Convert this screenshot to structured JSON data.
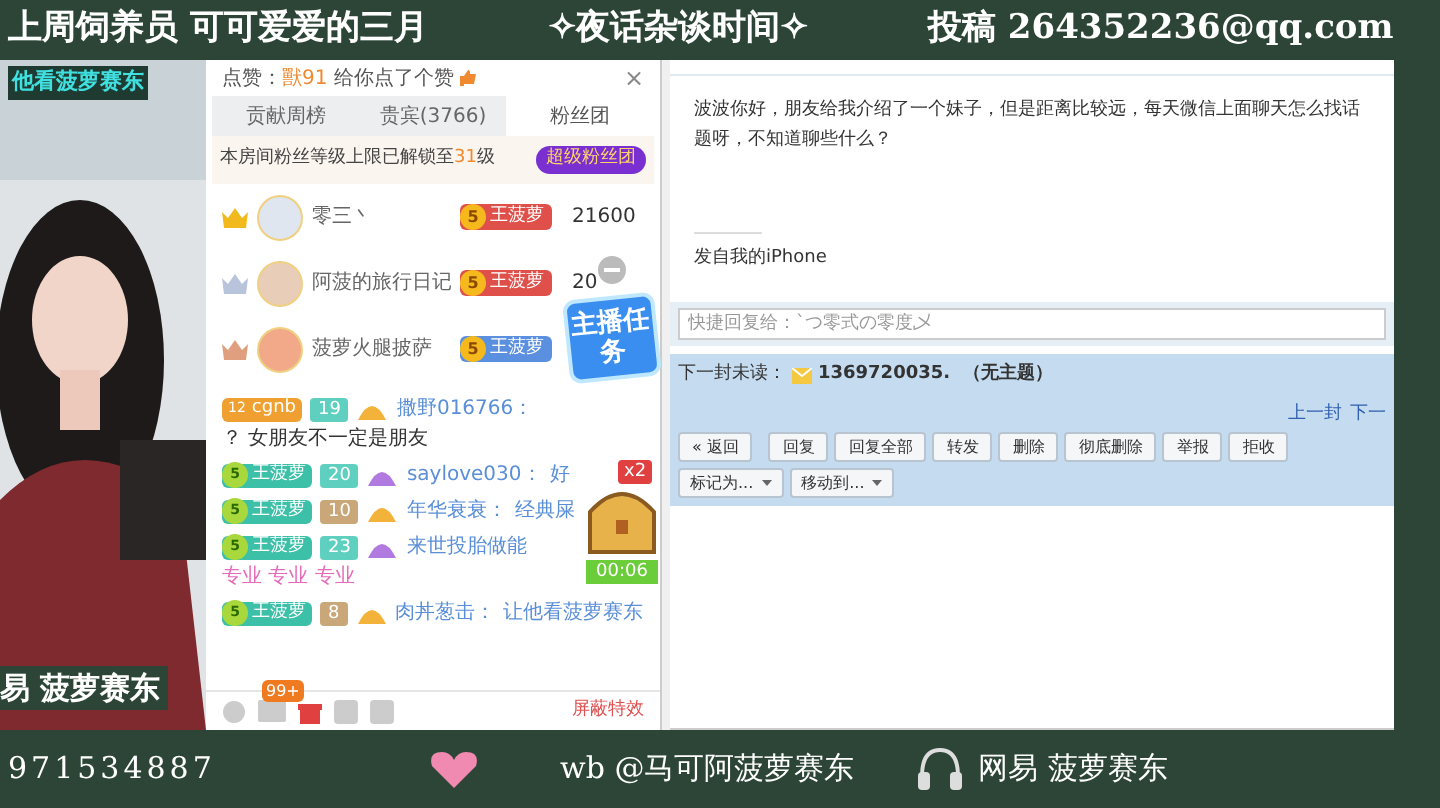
{
  "banner": {
    "left": "上周饲养员 可可爱爱的三月",
    "center": "✧夜话杂谈时间✧",
    "right": "投稿 264352236@qq.com"
  },
  "webcam": {
    "top_caption": "他看菠萝赛东",
    "bottom_caption": "易 菠萝赛东"
  },
  "chat_panel": {
    "like_notice": {
      "prefix": "点赞：",
      "user": "獸91",
      "text": "给你点了个赞",
      "close": "×"
    },
    "tabs": [
      {
        "label": "贡献周榜",
        "selected": false
      },
      {
        "label": "贵宾(3766)",
        "selected": false
      },
      {
        "label": "粉丝团",
        "selected": true
      }
    ],
    "fan_notice": {
      "text": "本房间粉丝等级上限已解锁至",
      "level": "31",
      "suffix": "级",
      "button": "超级粉丝团"
    },
    "ranking": [
      {
        "name": "零三丶",
        "badge_level": "5",
        "badge": "王菠萝",
        "score": "21600"
      },
      {
        "name": "阿菠的旅行日记",
        "badge_level": "5",
        "badge": "王菠萝",
        "score": "20"
      },
      {
        "name": "菠萝火腿披萨",
        "badge_level": "5",
        "badge": "王菠萝"
      }
    ],
    "task_sticker": "主播任务",
    "messages": [
      {
        "badge": {
          "kind": "level",
          "level": "12",
          "name": "cgnb"
        },
        "rank": {
          "text": "19",
          "color": "#5fd0c0"
        },
        "user": "撒野016766：",
        "text": "？ 女朋友不一定是朋友",
        "color": "#333333"
      },
      {
        "badge": {
          "kind": "fan",
          "level": "5",
          "name": "王菠萝"
        },
        "rank": {
          "text": "20",
          "color": "#5fd0c0"
        },
        "user": "saylove030：",
        "text": "好",
        "color": "#5a8fd8"
      },
      {
        "badge": {
          "kind": "fan",
          "level": "5",
          "name": "王菠萝"
        },
        "rank": {
          "text": "10",
          "color": "#c9a779"
        },
        "user": "年华衰衰：",
        "text": "经典屎",
        "color": "#5a8fd8"
      },
      {
        "badge": {
          "kind": "fan",
          "level": "5",
          "name": "王菠萝"
        },
        "rank": {
          "text": "23",
          "color": "#5fd0c0"
        },
        "user": "来世投胎做能",
        "text": "专业 专业 专业",
        "color": "#e76ab9"
      },
      {
        "badge": {
          "kind": "fan",
          "level": "5",
          "name": "王菠萝"
        },
        "rank": {
          "text": "8",
          "color": "#c9a779"
        },
        "user": "肉丼葱击：",
        "text": "让他看菠萝赛东",
        "color": "#5a8fd8"
      }
    ],
    "chest": {
      "multiplier": "x2",
      "timer": "00:06"
    },
    "toolbar": {
      "unread": "99+",
      "effects_button": "屏蔽特效"
    }
  },
  "email": {
    "body": "波波你好，朋友给我介绍了一个妹子，但是距离比较远，每天微信上面聊天怎么找话题呀，不知道聊些什么？",
    "signature": "发自我的iPhone",
    "quick_reply": {
      "placeholder": "快捷回复给：`つ零式の零度乄"
    },
    "next_unread": {
      "label": "下一封未读：",
      "subject": "1369720035.  （无主题）"
    },
    "nav": [
      "上一封",
      "下一"
    ],
    "buttons": [
      "« 返回",
      "回复",
      "回复全部",
      "转发",
      "删除",
      "彻底删除",
      "举报",
      "拒收"
    ],
    "dropdowns": [
      "标记为...",
      "移动到..."
    ]
  },
  "footer": {
    "qq": "971534887",
    "weibo": "wb @马可阿菠萝赛东",
    "netease": "网易 菠萝赛东"
  }
}
